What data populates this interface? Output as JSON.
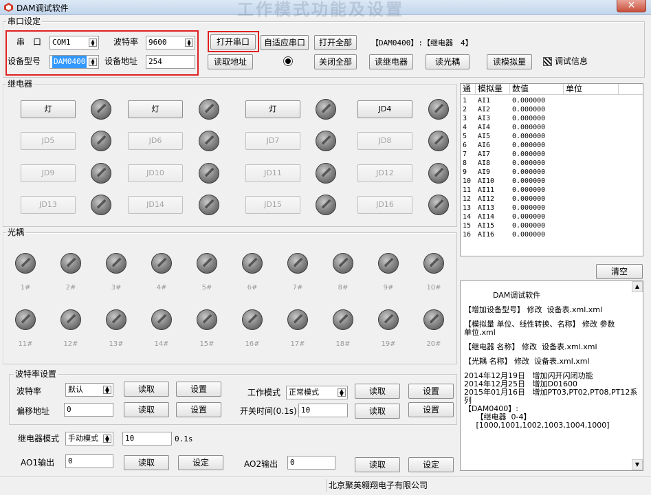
{
  "window": {
    "title": "DAM调试软件",
    "watermark": "工作模式功能及设置",
    "close_label": "✕"
  },
  "serial_settings": {
    "group_title": "串口设定",
    "port_label": "串　口",
    "port_value": "COM1",
    "baud_label": "波特率",
    "baud_value": "9600",
    "device_model_label": "设备型号",
    "device_model_value": "DAM0400",
    "device_address_label": "设备地址",
    "device_address_value": "254",
    "open_port_button": "打开串口",
    "adaptive_port_button": "自适应串口",
    "open_all_button": "打开全部",
    "device_info": "【DAM0400】:【继电器　4】",
    "read_address_button": "读取地址",
    "close_all_button": "关闭全部",
    "read_relay_button": "读继电器",
    "read_optocoupler_button": "读光耦",
    "read_analog_button": "读模拟量",
    "debug_info_label": "调试信息"
  },
  "relay": {
    "group_title": "继电器",
    "buttons": [
      "灯",
      "灯",
      "灯",
      "JD4",
      "JD5",
      "JD6",
      "JD7",
      "JD8",
      "JD9",
      "JD10",
      "JD11",
      "JD12",
      "JD13",
      "JD14",
      "JD15",
      "JD16"
    ],
    "enabled": [
      true,
      true,
      true,
      true,
      false,
      false,
      false,
      false,
      false,
      false,
      false,
      false,
      false,
      false,
      false,
      false
    ]
  },
  "optocoupler": {
    "group_title": "光耦",
    "labels": [
      "1#",
      "2#",
      "3#",
      "4#",
      "5#",
      "6#",
      "7#",
      "8#",
      "9#",
      "10#",
      "11#",
      "12#",
      "13#",
      "14#",
      "15#",
      "16#",
      "17#",
      "18#",
      "19#",
      "20#"
    ]
  },
  "baud_settings": {
    "group_title": "波特率设置",
    "baud_label": "波特率",
    "baud_value": "默认",
    "read_button": "读取",
    "set_button": "设置",
    "offset_label": "偏移地址",
    "offset_value": "0",
    "work_mode_label": "工作模式",
    "work_mode_value": "正常模式",
    "switch_time_label": "开关时间(0.1s)",
    "switch_time_value": "10",
    "relay_mode_label": "继电器模式",
    "relay_mode_value": "手动模式",
    "relay_mode_time": "10",
    "relay_mode_unit": "0.1s",
    "ao1_label": "AO1输出",
    "ao1_value": "0",
    "ao2_label": "AO2输出",
    "ao2_value": "0",
    "confirm_button": "设定"
  },
  "analog_table": {
    "headers": [
      "通",
      "模拟量",
      "数值",
      "单位"
    ],
    "rows": [
      [
        "1",
        "AI1",
        "0.000000",
        ""
      ],
      [
        "2",
        "AI2",
        "0.000000",
        ""
      ],
      [
        "3",
        "AI3",
        "0.000000",
        ""
      ],
      [
        "4",
        "AI4",
        "0.000000",
        ""
      ],
      [
        "5",
        "AI5",
        "0.000000",
        ""
      ],
      [
        "6",
        "AI6",
        "0.000000",
        ""
      ],
      [
        "7",
        "AI7",
        "0.000000",
        ""
      ],
      [
        "8",
        "AI8",
        "0.000000",
        ""
      ],
      [
        "9",
        "AI9",
        "0.000000",
        ""
      ],
      [
        "10",
        "AI10",
        "0.000000",
        ""
      ],
      [
        "11",
        "AI11",
        "0.000000",
        ""
      ],
      [
        "12",
        "AI12",
        "0.000000",
        ""
      ],
      [
        "13",
        "AI13",
        "0.000000",
        ""
      ],
      [
        "14",
        "AI14",
        "0.000000",
        ""
      ],
      [
        "15",
        "AI15",
        "0.000000",
        ""
      ],
      [
        "16",
        "AI16",
        "0.000000",
        ""
      ]
    ]
  },
  "log": {
    "clear_button": "清空",
    "lines": [
      "            DAM调试软件",
      "",
      "【增加设备型号】 修改  设备表.xml.xml",
      "",
      "【模拟量 单位、线性转换、名称】 修改 参数",
      "单位.xml",
      "",
      "【继电器 名称】 修改  设备表.xml.xml",
      "",
      "【光耦 名称】 修改  设备表.xml.xml",
      "",
      "2014年12月19日   增加闪开闪闭功能",
      "2014年12月25日   增加D01600",
      "2015年01月16日   增加PT03,PT02,PT08,PT12系",
      "列",
      "【DAM0400】:",
      "     【继电器  0-4】",
      "     [1000,1001,1002,1003,1004,1000]"
    ]
  },
  "statusbar": {
    "company": "北京聚英翱翔电子有限公司"
  }
}
